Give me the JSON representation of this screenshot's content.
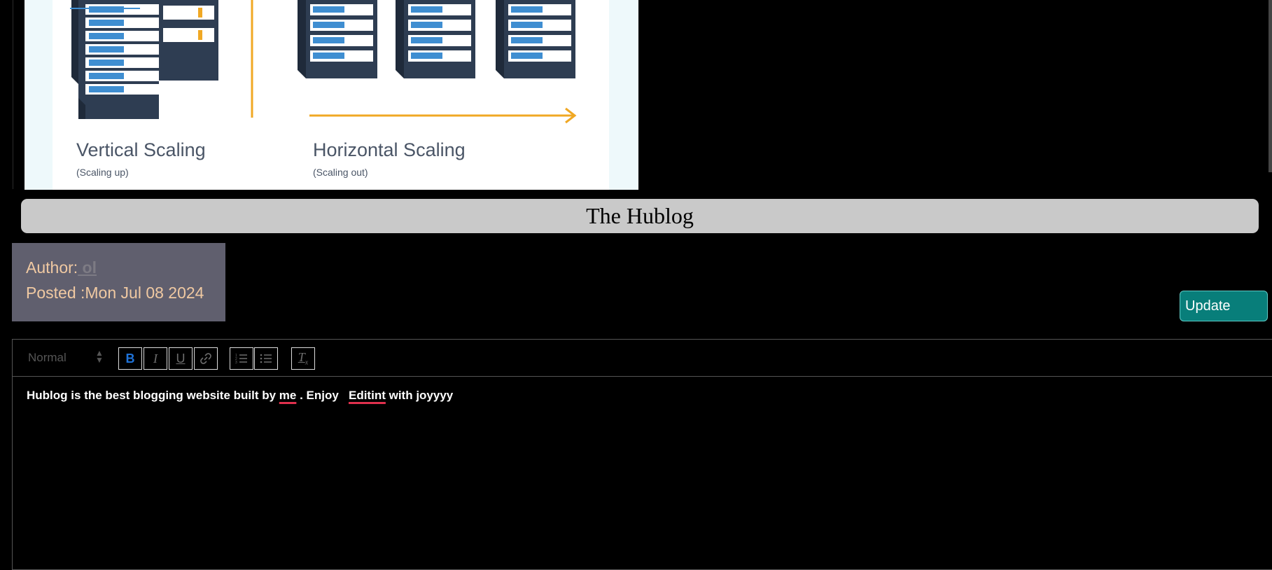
{
  "hero_image": {
    "left_caption": "Vertical Scaling",
    "left_subcaption": "(Scaling up)",
    "right_caption": "Horizontal Scaling",
    "right_subcaption": "(Scaling out)",
    "colors": {
      "server_body": "#2e3d52",
      "server_light": "#3f8ed1",
      "arrow": "#f0a824"
    }
  },
  "title": "The Hublog",
  "post_meta": {
    "author_label": "Author:",
    "author_name": " ol",
    "posted_label": "Posted :",
    "posted_date": "Mon Jul 08 2024"
  },
  "update_button": "Update",
  "editor": {
    "header_select": "Normal",
    "toolbar_icons": [
      "bold-icon",
      "italic-icon",
      "underline-icon",
      "link-icon",
      "ordered-list-icon",
      "bullet-list-icon",
      "clear-format-icon"
    ],
    "content": {
      "part1": "Hublog is the best blogging website built by ",
      "word_me": "me",
      "part2": " . Enjoy   ",
      "word_editint": "Editint",
      "part3": " with joyyyy"
    }
  },
  "colors": {
    "background": "#000000",
    "title_bar": "#c9c9c9",
    "meta_box": "#605f6e",
    "meta_text": "#f0c9a2",
    "update_button": "#087e7a",
    "active_tool": "#1f73d9"
  }
}
